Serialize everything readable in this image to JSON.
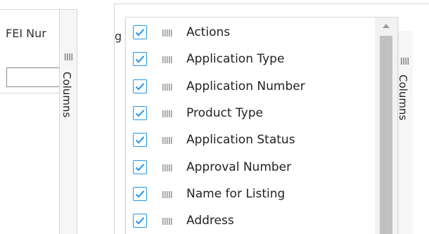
{
  "left_panel": {
    "header_text": "FEI Nur",
    "filter_value": "",
    "side_tab_label": "Columns"
  },
  "right_panel": {
    "header_text": "g",
    "side_tab_label": "Columns"
  },
  "columns_popup": {
    "items": [
      {
        "label": "Actions",
        "checked": true
      },
      {
        "label": "Application Type",
        "checked": true
      },
      {
        "label": "Application Number",
        "checked": true
      },
      {
        "label": "Product Type",
        "checked": true
      },
      {
        "label": "Application Status",
        "checked": true
      },
      {
        "label": "Approval Number",
        "checked": true
      },
      {
        "label": "Name for Listing",
        "checked": true
      },
      {
        "label": "Address",
        "checked": true
      }
    ]
  },
  "colors": {
    "checkbox_accent": "#2196f3",
    "border": "#d6d6d6",
    "scrollbar_track": "#f2f2f2",
    "scrollbar_thumb": "#c1c1c1"
  },
  "icons": {
    "grip": "grip-lines-icon",
    "drag": "drag-handle-icon",
    "check": "check-icon",
    "scroll_up": "chevron-up-icon"
  }
}
